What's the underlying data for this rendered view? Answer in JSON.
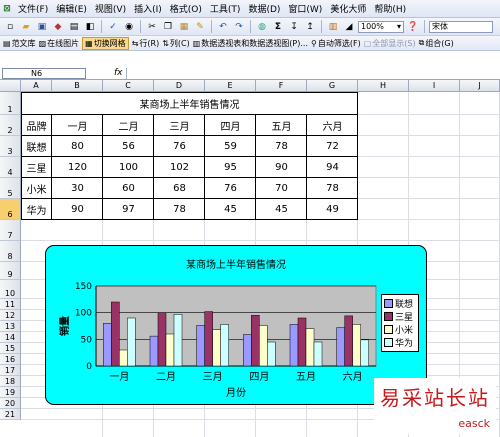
{
  "menu": [
    "文件(F)",
    "编辑(E)",
    "视图(V)",
    "插入(I)",
    "格式(O)",
    "工具(T)",
    "数据(D)",
    "窗口(W)",
    "美化大师",
    "帮助(H)"
  ],
  "toolbar": {
    "zoom": "100%",
    "font": "宋体"
  },
  "toolbar2": [
    "范文库",
    "在线图片",
    "切换网格",
    "行(R)",
    "列(C)",
    "数据透视表和数据透视图(P)...",
    "自动筛选(F)",
    "全部显示(S)",
    "组合(G)"
  ],
  "namebox": "N6",
  "fx": "fx",
  "columns": [
    "A",
    "B",
    "C",
    "D",
    "E",
    "F",
    "G",
    "H",
    "I",
    "J"
  ],
  "rows": [
    "1",
    "2",
    "3",
    "4",
    "5",
    "6",
    "7",
    "8",
    "9",
    "10",
    "11",
    "12",
    "13",
    "14",
    "15",
    "16",
    "17",
    "18",
    "19",
    "20",
    "21"
  ],
  "table": {
    "title": "某商场上半年销售情况",
    "header": [
      "品牌",
      "一月",
      "二月",
      "三月",
      "四月",
      "五月",
      "六月"
    ],
    "rows": [
      [
        "联想",
        "80",
        "56",
        "76",
        "59",
        "78",
        "72"
      ],
      [
        "三星",
        "120",
        "100",
        "102",
        "95",
        "90",
        "94"
      ],
      [
        "小米",
        "30",
        "60",
        "68",
        "76",
        "70",
        "78"
      ],
      [
        "华为",
        "90",
        "97",
        "78",
        "45",
        "45",
        "49"
      ]
    ]
  },
  "chart_data": {
    "type": "bar",
    "title": "某商场上半年销售情况",
    "xlabel": "月份",
    "ylabel": "销量",
    "categories": [
      "一月",
      "二月",
      "三月",
      "四月",
      "五月",
      "六月"
    ],
    "ylim": [
      0,
      150
    ],
    "yticks": [
      "0",
      "50",
      "100",
      "150"
    ],
    "legend_position": "right",
    "series": [
      {
        "name": "联想",
        "color": "#9999ff",
        "values": [
          80,
          56,
          76,
          59,
          78,
          72
        ]
      },
      {
        "name": "三星",
        "color": "#993366",
        "values": [
          120,
          100,
          102,
          95,
          90,
          94
        ]
      },
      {
        "name": "小米",
        "color": "#ffffcc",
        "values": [
          30,
          60,
          68,
          76,
          70,
          78
        ]
      },
      {
        "name": "华为",
        "color": "#ccffff",
        "values": [
          90,
          97,
          78,
          45,
          45,
          49
        ]
      }
    ]
  },
  "watermark": {
    "cn": "易采站长站",
    "en": "easck"
  },
  "colors": {
    "selected_row": "#f8cf6e",
    "chart_bg": "#00ffff",
    "plot_bg": "#c0c0c0",
    "watermark": "#c6191b"
  }
}
